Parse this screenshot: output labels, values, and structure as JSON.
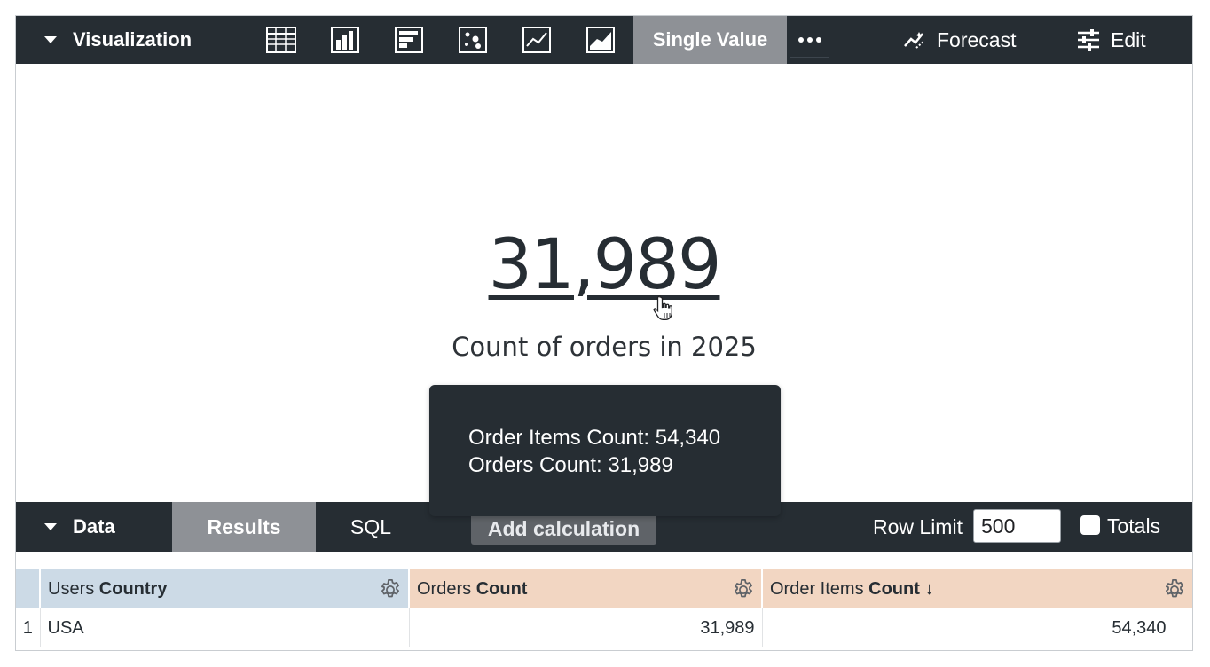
{
  "viz_bar": {
    "title": "Visualization",
    "viz_types": [
      {
        "name": "table-icon"
      },
      {
        "name": "column-chart-icon"
      },
      {
        "name": "bar-chart-icon"
      },
      {
        "name": "scatter-chart-icon"
      },
      {
        "name": "line-chart-icon"
      },
      {
        "name": "area-chart-icon"
      }
    ],
    "active_type": "Single Value",
    "forecast_label": "Forecast",
    "edit_label": "Edit"
  },
  "single_value": {
    "value": "31,989",
    "caption": "Count of orders in 2025"
  },
  "tooltip": {
    "line1": "Order Items Count: 54,340",
    "line2": "Orders Count: 31,989"
  },
  "data_bar": {
    "title": "Data",
    "tabs": {
      "results": "Results",
      "sql": "SQL"
    },
    "add_calculation": "Add calculation",
    "row_limit_label": "Row Limit",
    "row_limit_value": "500",
    "totals_label": "Totals",
    "totals_checked": false
  },
  "table": {
    "columns": [
      {
        "view": "Users",
        "field": "Country",
        "suffix": ""
      },
      {
        "view": "Orders",
        "field": "Count",
        "suffix": ""
      },
      {
        "view": "Order Items",
        "field": "Count",
        "suffix": "↓"
      }
    ],
    "rows": [
      {
        "num": "1",
        "country": "USA",
        "orders_count": "31,989",
        "order_items_count": "54,340"
      }
    ]
  },
  "colors": {
    "toolbar_bg": "#262d33",
    "active_tab_bg": "#8e9196",
    "dimension_header": "#ccdae6",
    "measure_header": "#f2d6c2"
  }
}
